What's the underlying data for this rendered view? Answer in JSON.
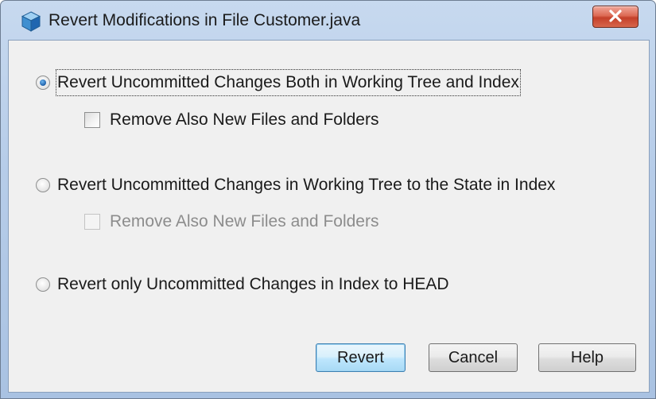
{
  "window": {
    "title": "Revert Modifications in File Customer.java",
    "icon": "netbeans-cube-icon",
    "close_icon": "close-x-icon"
  },
  "options": [
    {
      "label": "Revert Uncommitted Changes Both in Working Tree and Index",
      "selected": true,
      "enabled": true,
      "sub_checkbox": {
        "label": "Remove Also New Files and Folders",
        "checked": false,
        "enabled": true
      }
    },
    {
      "label": "Revert Uncommitted Changes in Working Tree to the State in Index",
      "selected": false,
      "enabled": true,
      "sub_checkbox": {
        "label": "Remove Also New Files and Folders",
        "checked": false,
        "enabled": false
      }
    },
    {
      "label": "Revert only Uncommitted Changes in Index to HEAD",
      "selected": false,
      "enabled": true
    }
  ],
  "buttons": {
    "revert": "Revert",
    "cancel": "Cancel",
    "help": "Help"
  },
  "colors": {
    "title_bar": "#b7cde9",
    "close_button": "#c4402a",
    "dialog_background": "#f0f0f0",
    "default_button": "#bee6fd"
  }
}
